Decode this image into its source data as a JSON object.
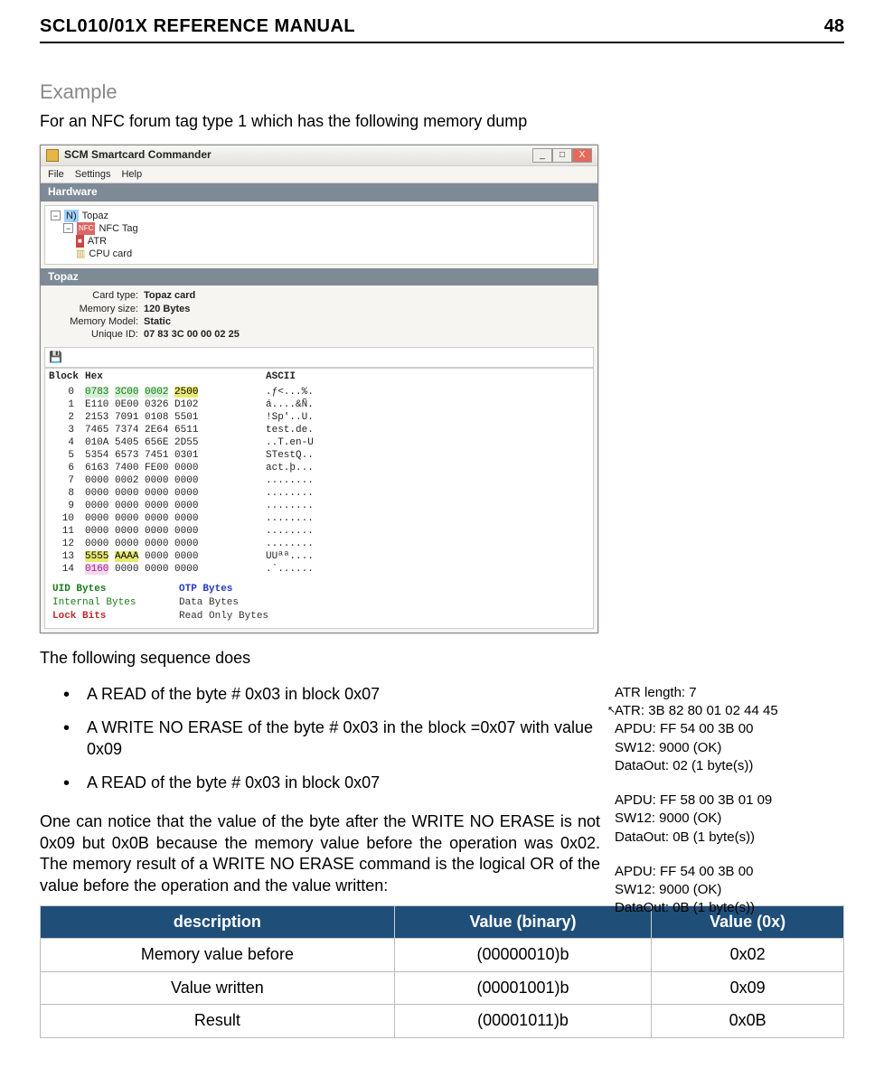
{
  "header": {
    "title": "SCL010/01X REFERENCE MANUAL",
    "page": "48"
  },
  "doc": {
    "example_heading": "Example",
    "intro": "For an NFC forum tag type 1 which has the following memory dump",
    "seq_intro": "The following sequence does",
    "bullets": [
      "A READ of the byte # 0x03 in block 0x07",
      "A WRITE NO ERASE of the byte # 0x03 in the block =0x07 with value 0x09",
      "A READ of the byte # 0x03 in block 0x07"
    ],
    "or_para": "One can notice that the value of the byte after the WRITE NO ERASE is not 0x09 but 0x0B because the memory value before the operation was 0x02. The memory result of a WRITE NO ERASE command is the logical OR of the value before the operation and the value written:"
  },
  "app": {
    "title": "SCM Smartcard Commander",
    "menu": [
      "File",
      "Settings",
      "Help"
    ],
    "section_hardware": "Hardware",
    "tree": {
      "topaz": "Topaz",
      "nfc": "NFC Tag",
      "atr": "ATR",
      "cpu": "CPU card"
    },
    "section_topaz": "Topaz",
    "props": {
      "card_type_l": "Card type:",
      "card_type": "Topaz card",
      "mem_size_l": "Memory size:",
      "mem_size": "120 Bytes",
      "mem_model_l": "Memory Model:",
      "mem_model": "Static",
      "uid_l": "Unique ID:",
      "uid": "07 83 3C 00 00 02 25"
    },
    "hex_hdr": {
      "block": "Block",
      "hex": "Hex",
      "ascii": "ASCII"
    },
    "hex_rows": [
      {
        "n": "0",
        "h": "0783 3C00 0002 2500",
        "a": ".ƒ<...%.",
        "cls": [
          "g",
          "g",
          "g",
          "y"
        ]
      },
      {
        "n": "1",
        "h": "E110 0E00 0326 D102",
        "a": "á....&Ñ."
      },
      {
        "n": "2",
        "h": "2153 7091 0108 5501",
        "a": "!Sp'..U."
      },
      {
        "n": "3",
        "h": "7465 7374 2E64 6511",
        "a": "test.de."
      },
      {
        "n": "4",
        "h": "010A 5405 656E 2D55",
        "a": "..T.en-U"
      },
      {
        "n": "5",
        "h": "5354 6573 7451 0301",
        "a": "STestQ.."
      },
      {
        "n": "6",
        "h": "6163 7400 FE00 0000",
        "a": "act.þ..."
      },
      {
        "n": "7",
        "h": "0000 0002 0000 0000",
        "a": "........"
      },
      {
        "n": "8",
        "h": "0000 0000 0000 0000",
        "a": "........"
      },
      {
        "n": "9",
        "h": "0000 0000 0000 0000",
        "a": "........"
      },
      {
        "n": "10",
        "h": "0000 0000 0000 0000",
        "a": "........"
      },
      {
        "n": "11",
        "h": "0000 0000 0000 0000",
        "a": "........"
      },
      {
        "n": "12",
        "h": "0000 0000 0000 0000",
        "a": "........"
      },
      {
        "n": "13",
        "h": "5555 AAAA 0000 0000",
        "a": "UUªª....",
        "cls": [
          "y",
          "y",
          "nm",
          "nm"
        ]
      },
      {
        "n": "14",
        "h": "0160 0000 0000 0000",
        "a": ".`......",
        "first": "pk"
      }
    ],
    "legend": {
      "uid": "UID Bytes",
      "otp": "OTP Bytes",
      "internal": "Internal Bytes",
      "data": "Data Bytes",
      "lock": "Lock Bits",
      "ro": "Read Only Bytes"
    }
  },
  "log": {
    "blk1": {
      "atr_len": "ATR length: 7",
      "atr": "ATR: 3B 82 80 01 02 44 45",
      "apdu": "APDU: FF 54 00 3B 00",
      "sw": "SW12: 9000 (OK)",
      "out": "DataOut: 02 (1 byte(s))"
    },
    "blk2": {
      "apdu": "APDU: FF 58 00 3B 01 09",
      "sw": "SW12: 9000 (OK)",
      "out": "DataOut: 0B (1 byte(s))"
    },
    "blk3": {
      "apdu": "APDU: FF 54 00 3B 00",
      "sw": "SW12: 9000 (OK)",
      "out": "DataOut: 0B (1 byte(s))"
    }
  },
  "table": {
    "headers": {
      "desc": "description",
      "bin": "Value (binary)",
      "hex": "Value (0x)"
    },
    "rows": [
      {
        "d": "Memory value before",
        "b": "(00000010)b",
        "h": "0x02"
      },
      {
        "d": "Value written",
        "b": "(00001001)b",
        "h": "0x09"
      },
      {
        "d": "Result",
        "b": "(00001011)b",
        "h": "0x0B"
      }
    ]
  }
}
